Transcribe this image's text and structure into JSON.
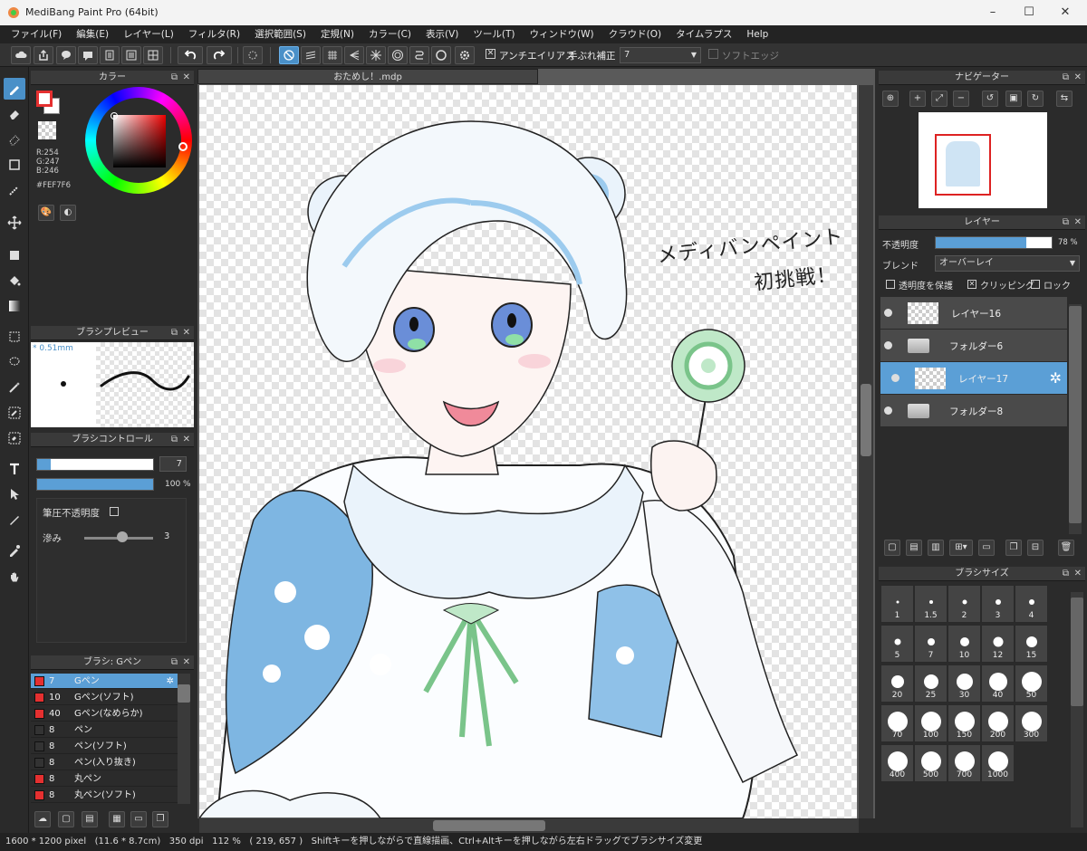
{
  "window": {
    "title": "MediBang Paint Pro (64bit)"
  },
  "menu": [
    "ファイル(F)",
    "編集(E)",
    "レイヤー(L)",
    "フィルタ(R)",
    "選択範囲(S)",
    "定規(N)",
    "カラー(C)",
    "表示(V)",
    "ツール(T)",
    "ウィンドウ(W)",
    "クラウド(O)",
    "タイムラプス",
    "Help"
  ],
  "toolbar": {
    "antialias_label": "アンチエイリアス",
    "stabilizer_label": "手ぶれ補正",
    "stabilizer_value": "7",
    "softedge_label": "ソフトエッジ"
  },
  "color_panel": {
    "title": "カラー",
    "r": "R:254",
    "g": "G:247",
    "b": "B:246",
    "hex": "#FEF7F6",
    "fg_color": "#e53030",
    "bg_color": "#ffffff"
  },
  "brush_preview": {
    "title": "ブラシプレビュー",
    "size_label": "* 0.51mm"
  },
  "brush_control": {
    "title": "ブラシコントロール",
    "size_value": "7",
    "opacity_value": "100 %",
    "pressure_opacity_label": "筆圧不透明度",
    "blur_label": "滲み",
    "blur_value": "3"
  },
  "brush_list": {
    "title": "ブラシ: Gペン",
    "items": [
      {
        "size": "7",
        "name": "Gペン",
        "color": "#e53030",
        "selected": true
      },
      {
        "size": "10",
        "name": "Gペン(ソフト)",
        "color": "#e53030"
      },
      {
        "size": "40",
        "name": "Gペン(なめらか)",
        "color": "#e53030"
      },
      {
        "size": "8",
        "name": "ペン",
        "color": "#333333"
      },
      {
        "size": "8",
        "name": "ペン(ソフト)",
        "color": "#333333"
      },
      {
        "size": "8",
        "name": "ペン(入り抜き)",
        "color": "#333333"
      },
      {
        "size": "8",
        "name": "丸ペン",
        "color": "#e53030"
      },
      {
        "size": "8",
        "name": "丸ペン(ソフト)",
        "color": "#e53030"
      }
    ]
  },
  "document": {
    "tab_label": "おためし！.mdp",
    "handwritten_line1": "メディバンペイント",
    "handwritten_line2": "初挑戦！"
  },
  "navigator": {
    "title": "ナビゲーター"
  },
  "layer_panel": {
    "title": "レイヤー",
    "opacity_label": "不透明度",
    "opacity_value": "78 %",
    "opacity_fraction": 0.78,
    "blend_label": "ブレンド",
    "blend_value": "オーバーレイ",
    "protect_alpha_label": "透明度を保護",
    "clipping_label": "クリッピング",
    "lock_label": "ロック",
    "layers": [
      {
        "name": "レイヤー16",
        "type": "layer"
      },
      {
        "name": "フォルダー6",
        "type": "folder"
      },
      {
        "name": "レイヤー17",
        "type": "layer",
        "selected": true
      },
      {
        "name": "フォルダー8",
        "type": "folder"
      }
    ]
  },
  "brush_size_panel": {
    "title": "ブラシサイズ",
    "sizes": [
      "1",
      "1.5",
      "2",
      "3",
      "4",
      "5",
      "7",
      "10",
      "12",
      "15",
      "20",
      "25",
      "30",
      "40",
      "50",
      "70",
      "100",
      "150",
      "200",
      "300",
      "400",
      "500",
      "700",
      "1000"
    ]
  },
  "status": {
    "dims": "1600 * 1200 pixel",
    "phys": "(11.6 * 8.7cm)",
    "dpi": "350 dpi",
    "zoom": "112 %",
    "coords": "( 219, 657 )",
    "hint": "Shiftキーを押しながらで直線描画、Ctrl+Altキーを押しながら左右ドラッグでブラシサイズ変更"
  }
}
